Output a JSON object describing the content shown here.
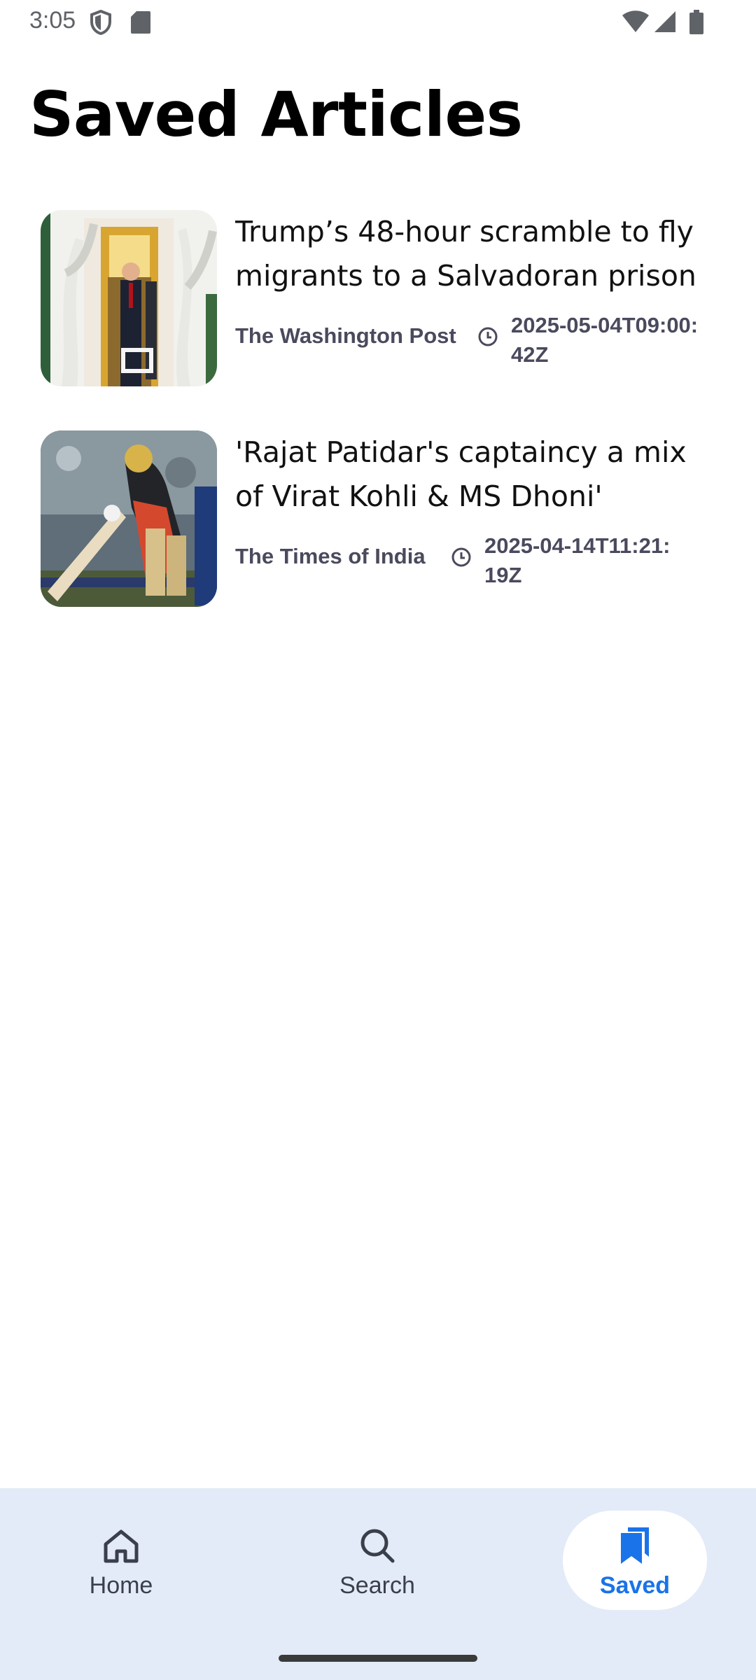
{
  "status_bar": {
    "time": "3:05",
    "icons": [
      "shield-icon",
      "sd-card-icon",
      "wifi-icon",
      "cell-signal-icon",
      "battery-icon"
    ]
  },
  "page": {
    "title": "Saved Articles"
  },
  "articles": [
    {
      "headline": "Trump’s 48-hour scramble to fly migrants to a Salvadoran prison",
      "source": "The Washington Post",
      "date": "2025-05-04T09:00:42Z"
    },
    {
      "headline": "'Rajat Patidar's captaincy a mix of Virat Kohli & MS Dhoni'",
      "source": "The Times of India",
      "date": "2025-04-14T11:21:19Z"
    }
  ],
  "bottom_nav": {
    "items": [
      {
        "label": "Home",
        "icon": "home-icon"
      },
      {
        "label": "Search",
        "icon": "search-icon"
      },
      {
        "label": "Saved",
        "icon": "bookmarks-icon",
        "active": true
      }
    ]
  },
  "colors": {
    "accent": "#1a73e8",
    "nav_background": "#e3ebf8",
    "meta_text": "#4a4a5e"
  }
}
